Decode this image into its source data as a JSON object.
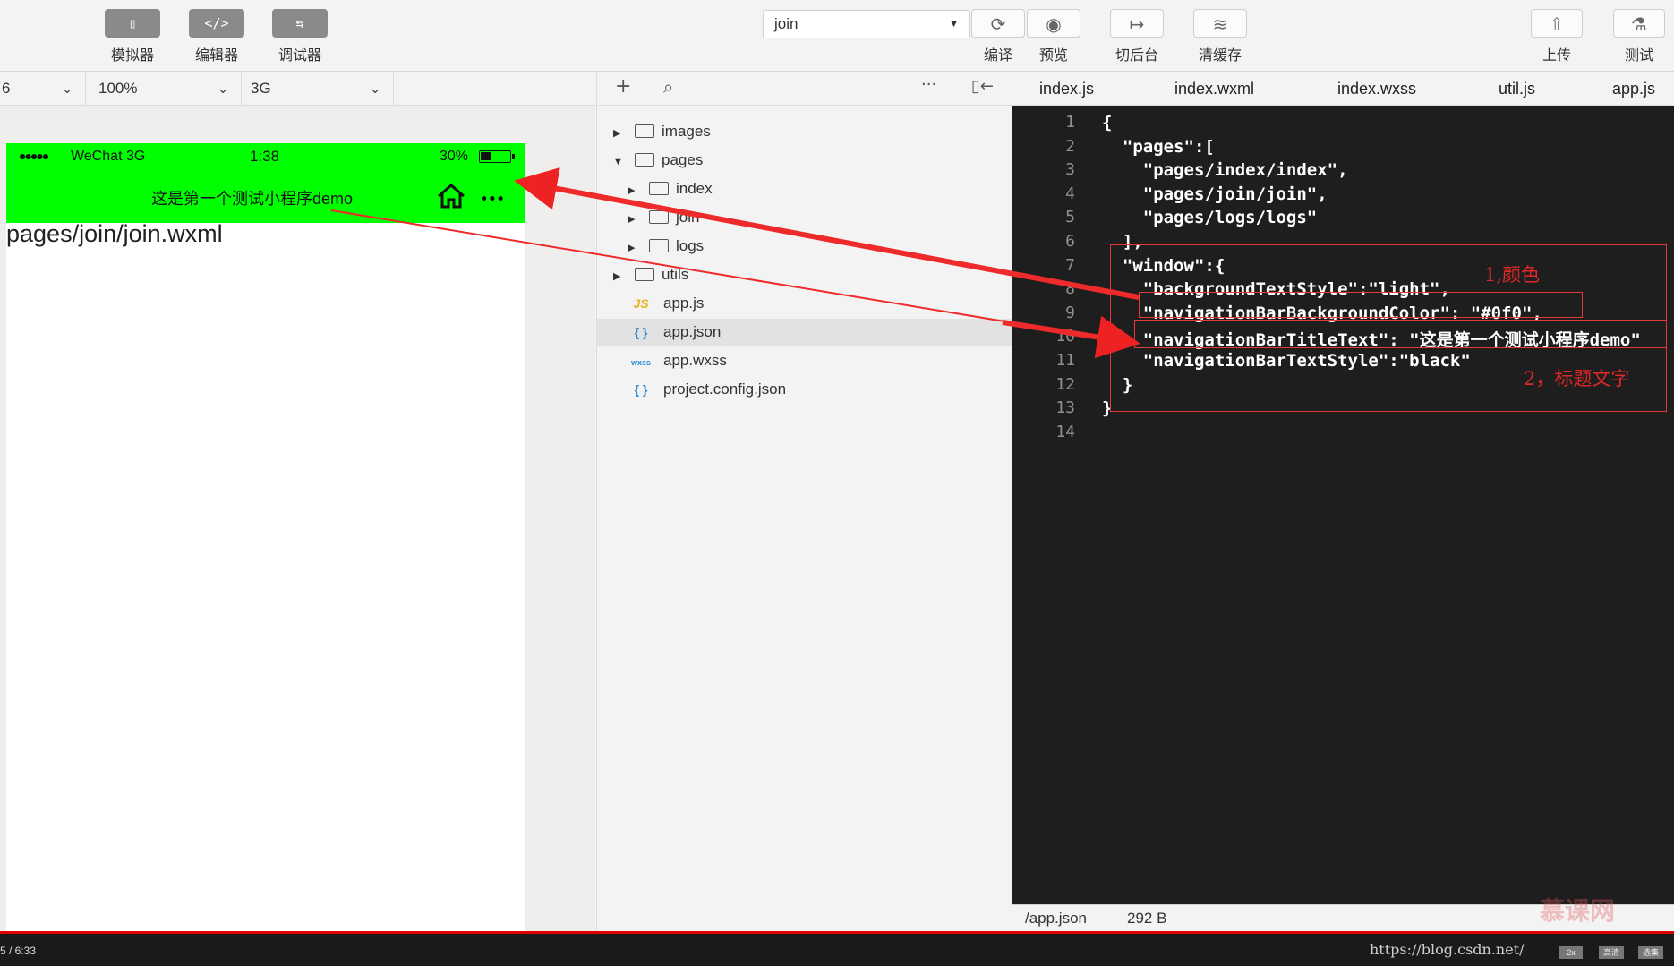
{
  "toolbar": {
    "simulator_label": "模拟器",
    "editor_label": "编辑器",
    "debugger_label": "调试器",
    "compile_mode": "join",
    "compile_label": "编译",
    "preview_label": "预览",
    "background_label": "切后台",
    "clear_cache_label": "清缓存",
    "upload_label": "上传",
    "test_label": "测试"
  },
  "simulator": {
    "device": "6",
    "zoom": "100%",
    "network": "3G",
    "status_signal": "●●●●●",
    "status_carrier": "WeChat 3G",
    "status_time": "1:38",
    "status_battery": "30%",
    "nav_title": "这是第一个测试小程序demo",
    "nav_background": "#00ff00",
    "page_path": "pages/join/join.wxml"
  },
  "file_tree": {
    "items": [
      {
        "name": "images"
      },
      {
        "name": "pages"
      },
      {
        "name": "index"
      },
      {
        "name": "join"
      },
      {
        "name": "logs"
      },
      {
        "name": "utils"
      },
      {
        "name": "app.js",
        "badge": "JS"
      },
      {
        "name": "app.json",
        "badge": "{ }"
      },
      {
        "name": "app.wxss",
        "badge": "wxss"
      },
      {
        "name": "project.config.json",
        "badge": "{ }"
      }
    ]
  },
  "editor": {
    "tabs": [
      "index.js",
      "index.wxml",
      "index.wxss",
      "util.js",
      "app.js"
    ],
    "line_numbers": [
      "1",
      "2",
      "3",
      "4",
      "5",
      "6",
      "7",
      "8",
      "9",
      "10",
      "11",
      "12",
      "13",
      "14"
    ],
    "lines": [
      "{",
      "  \"pages\":[",
      "    \"pages/index/index\",",
      "    \"pages/join/join\",",
      "    \"pages/logs/logs\"",
      "  ],",
      "  \"window\":{",
      "    \"backgroundTextStyle\":\"light\",",
      "    \"navigationBarBackgroundColor\": \"#0f0\",",
      "    \"navigationBarTitleText\": \"这是第一个测试小程序demo\"",
      "    \"navigationBarTextStyle\":\"black\"",
      "  }",
      "}",
      ""
    ],
    "file_path": "/app.json",
    "file_size": "292 B"
  },
  "annotations": {
    "color_note": "1,颜色",
    "title_note": "2，标题文字"
  },
  "video": {
    "time": "5 / 6:33",
    "url": "https://blog.csdn.net/",
    "watermark": "慕课网",
    "chips": [
      "2x",
      "高清",
      "选集"
    ]
  }
}
